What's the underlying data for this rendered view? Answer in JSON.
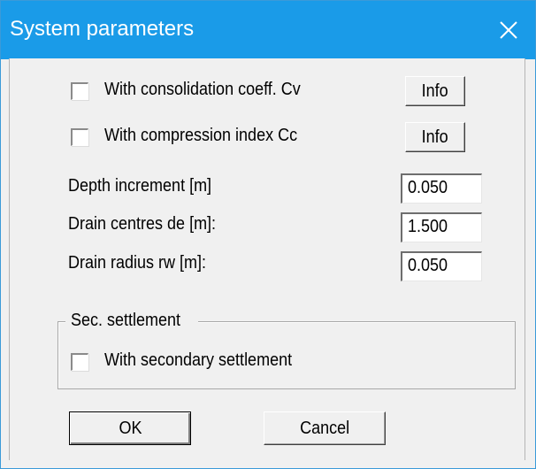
{
  "window": {
    "title": "System parameters",
    "close_glyph": "✕",
    "titlebar_color": "#1a9be8"
  },
  "options": {
    "consolidation": {
      "label": "With consolidation coeff. Cv",
      "checked": false,
      "info_label": "Info"
    },
    "compression": {
      "label": "With compression index Cc",
      "checked": false,
      "info_label": "Info"
    }
  },
  "params": {
    "depth_increment": {
      "label": "Depth increment [m]",
      "value": "0.050"
    },
    "drain_centres": {
      "label": "Drain centres de [m]:",
      "value": "1.500"
    },
    "drain_radius": {
      "label": "Drain radius rw [m]:",
      "value": "0.050"
    }
  },
  "secondary": {
    "group_label": "Sec. settlement",
    "checkbox_label": "With secondary settlement",
    "checked": false
  },
  "buttons": {
    "ok": "OK",
    "cancel": "Cancel"
  }
}
